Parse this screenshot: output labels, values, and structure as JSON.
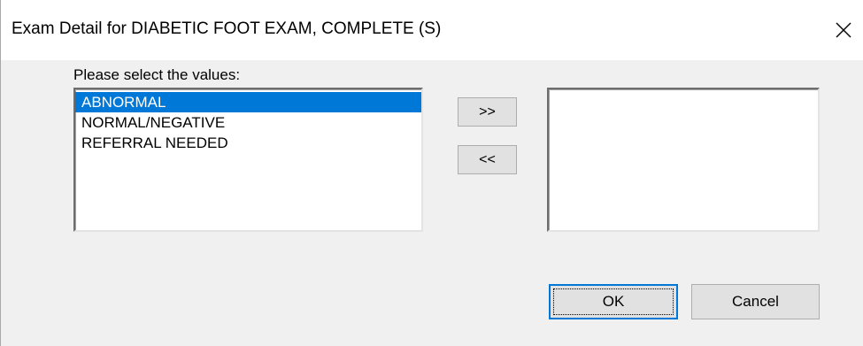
{
  "window": {
    "title": "Exam Detail for  DIABETIC FOOT EXAM, COMPLETE (S)",
    "close_glyph": "✕",
    "close_icon": "close-icon"
  },
  "prompt": "Please select the values:",
  "available_list": {
    "items": [
      "ABNORMAL",
      "NORMAL/NEGATIVE",
      "REFERRAL NEEDED"
    ],
    "highlighted_item": "ABNORMAL"
  },
  "selected_list": {
    "items": []
  },
  "buttons": {
    "add_label": ">>",
    "remove_label": "<<",
    "ok_label": "OK",
    "cancel_label": "Cancel"
  },
  "colors": {
    "selection_highlight": "#0078d7",
    "dialog_background": "#f0f0f0",
    "default_button_border": "#0078d7"
  }
}
